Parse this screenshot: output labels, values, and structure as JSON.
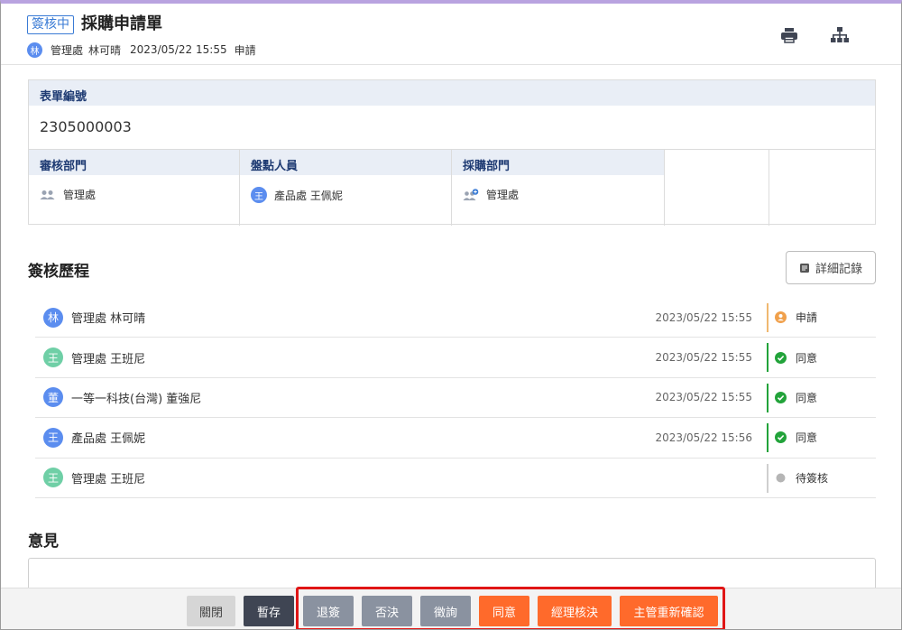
{
  "header": {
    "status": "簽核中",
    "title": "採購申請單",
    "applicant_avatar": "林",
    "applicant_dept": "管理處",
    "applicant_name": "林可晴",
    "apply_time": "2023/05/22 15:55",
    "apply_action": "申請",
    "print_icon": "print-icon",
    "flow_icon": "org-chart-icon"
  },
  "form": {
    "number_label": "表單編號",
    "number_value": "2305000003",
    "fields": [
      {
        "label": "審核部門",
        "value": "管理處",
        "icon": "group-icon"
      },
      {
        "label": "盤點人員",
        "value": "產品處 王佩妮",
        "avatar": "王"
      },
      {
        "label": "採購部門",
        "value": "管理處",
        "icon": "group-add-icon"
      }
    ]
  },
  "history": {
    "title": "簽核歷程",
    "detail_button": "詳細記錄",
    "rows": [
      {
        "avatar": "林",
        "color": "#5b8def",
        "name": "管理處  林可晴",
        "time": "2023/05/22 15:55",
        "status": "申請",
        "status_color": "#f0a04b",
        "bar_color": "#f0b870"
      },
      {
        "avatar": "王",
        "color": "#6fcfa6",
        "name": "管理處  王班尼",
        "time": "2023/05/22 15:55",
        "status": "同意",
        "status_color": "#22a33a",
        "bar_color": "#22a33a"
      },
      {
        "avatar": "董",
        "color": "#5b8def",
        "name": "一等一科技(台灣)  董強尼",
        "time": "2023/05/22 15:55",
        "status": "同意",
        "status_color": "#22a33a",
        "bar_color": "#22a33a"
      },
      {
        "avatar": "王",
        "color": "#5b8def",
        "name": "產品處  王佩妮",
        "time": "2023/05/22 15:56",
        "status": "同意",
        "status_color": "#22a33a",
        "bar_color": "#22a33a"
      },
      {
        "avatar": "王",
        "color": "#6fcfa6",
        "name": "管理處  王班尼",
        "time": "",
        "status": "待簽核",
        "status_color": "#b5b5b5",
        "bar_color": "#cfcfcf"
      }
    ]
  },
  "opinion": {
    "title": "意見",
    "value": ""
  },
  "footer": {
    "close": "關閉",
    "save": "暫存",
    "return": "退簽",
    "reject": "否決",
    "inquire": "徵詢",
    "agree": "同意",
    "manager_decide": "經理核決",
    "supervisor_recheck": "主管重新確認"
  },
  "colors": {
    "accent_blue": "#3a7bd5",
    "orange": "#ff6a2b",
    "dark_button": "#3f4553",
    "highlight": "#e01616"
  }
}
